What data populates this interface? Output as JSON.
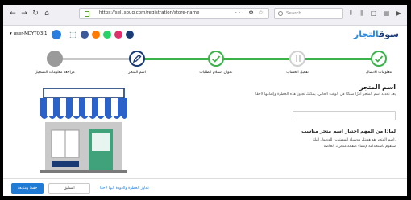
{
  "browser": {
    "url": "https://sell.souq.com/registration/store-name",
    "url_actions": "··· ✿ ☆",
    "search_placeholder": "Search",
    "toolbar_icons": "⬇ ⫼ ▢ ▤ ▶ ☰"
  },
  "appbar": {
    "user_label": "▾ user-MDYTQ3I1",
    "logo_main": "سوق",
    "logo_accent": "التجار"
  },
  "stepper": {
    "steps": [
      {
        "label": "معلومات الاتصال",
        "state": "done"
      },
      {
        "label": "تفعيل الحساب",
        "state": "pending"
      },
      {
        "label": "عنوان استلام الطلبات",
        "state": "done"
      },
      {
        "label": "اسم المتجر",
        "state": "current"
      },
      {
        "label": "مراجعة معلومات التسجيل",
        "state": "upcoming"
      }
    ],
    "colors": {
      "done": "#3bb34a",
      "current": "#1b3b75",
      "upcoming": "#9a9a9a",
      "pending": "#d0d0d0"
    }
  },
  "content": {
    "title": "اسم المتجر",
    "subtitle": "يعد تحديد اسم المتجر أمرًا ممكنًا في الوقت الحالي، يمكنك تجاوز هذه الخطوة وإتمامها لاحقًا",
    "store_input_placeholder": "",
    "why_title": "لماذا من المهم اختيار اسم متجر مناسب",
    "why_lines": [
      "اسم المتجر هو هويتك ووسيلة المشترين للوصول إليك.",
      "ستقوم باستخدامه لإنشاء صفحة متجرك الخاصة"
    ]
  },
  "footer": {
    "primary_label": "حفظ ومتابعة",
    "secondary_label": "السابق",
    "skip_label": "تجاوز الخطوة والعودة إليها لاحقًا"
  }
}
